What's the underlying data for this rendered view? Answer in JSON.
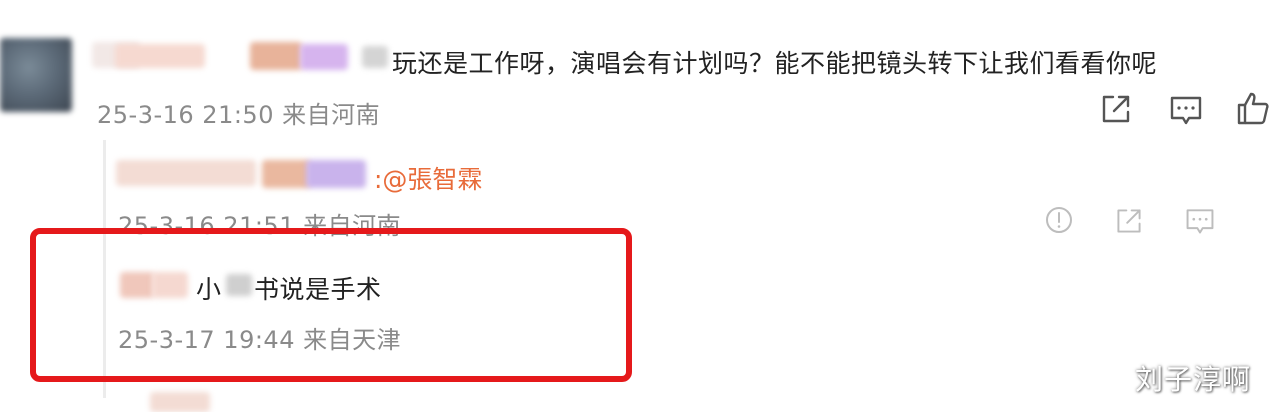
{
  "comment": {
    "text_visible": "玩还是工作呀，演唱会有计划吗？能不能把镜头转下让我们看看你呢",
    "meta": "25-3-16 21:50 来自河南"
  },
  "reply1": {
    "mention": ":@張智霖",
    "meta": "25-3-16 21:51 来自河南"
  },
  "reply2": {
    "text_part1": "小",
    "text_part2": "书说是手术",
    "meta": "25-3-17 19:44 来自天津"
  },
  "icons": {
    "share": "share-icon",
    "comment": "comment-icon",
    "like": "thumbs-up-icon",
    "report": "report-icon"
  },
  "colors": {
    "highlight": "#e5191b",
    "mention": "#e86b3a",
    "meta": "#8a8a8a"
  },
  "watermark": "刘子淳啊"
}
